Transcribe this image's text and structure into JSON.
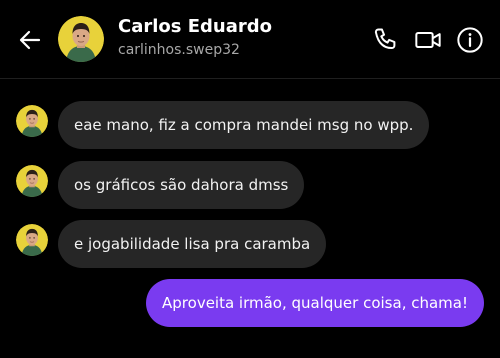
{
  "contact": {
    "name": "Carlos Eduardo",
    "handle": "carlinhos.swep32"
  },
  "header_icons": [
    "back-arrow-icon",
    "phone-icon",
    "video-camera-icon",
    "info-icon"
  ],
  "messages": [
    {
      "direction": "incoming",
      "text": "eae mano, fiz a compra mandei msg no wpp."
    },
    {
      "direction": "incoming",
      "text": "os gráficos são dahora dmss"
    },
    {
      "direction": "incoming",
      "text": "e jogabilidade lisa pra caramba"
    },
    {
      "direction": "outgoing",
      "text": "Aproveita irmão, qualquer coisa, chama!"
    }
  ],
  "colors": {
    "background": "#000000",
    "incoming_bubble": "#262626",
    "outgoing_bubble": "#7a3bf0",
    "avatar_background": "#e8d23a"
  }
}
